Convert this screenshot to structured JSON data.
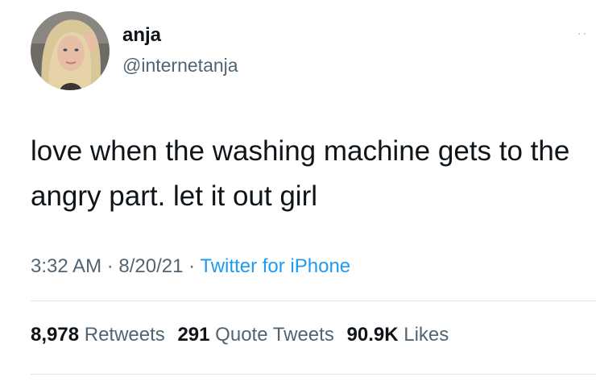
{
  "author": {
    "display_name": "anja",
    "handle": "@internetanja"
  },
  "tweet": {
    "text": "love when the washing machine gets to the angry part. let it out girl",
    "time": "3:32 AM",
    "date": "8/20/21",
    "separator": "·",
    "source": "Twitter for iPhone"
  },
  "stats": {
    "retweets_count": "8,978",
    "retweets_label": "Retweets",
    "quotes_count": "291",
    "quotes_label": "Quote Tweets",
    "likes_count": "90.9K",
    "likes_label": "Likes"
  },
  "icons": {
    "more": "more-dots-icon",
    "avatar": "avatar"
  },
  "colors": {
    "link": "#1d9bf0",
    "secondary_text": "#536471",
    "primary_text": "#0f1419"
  }
}
